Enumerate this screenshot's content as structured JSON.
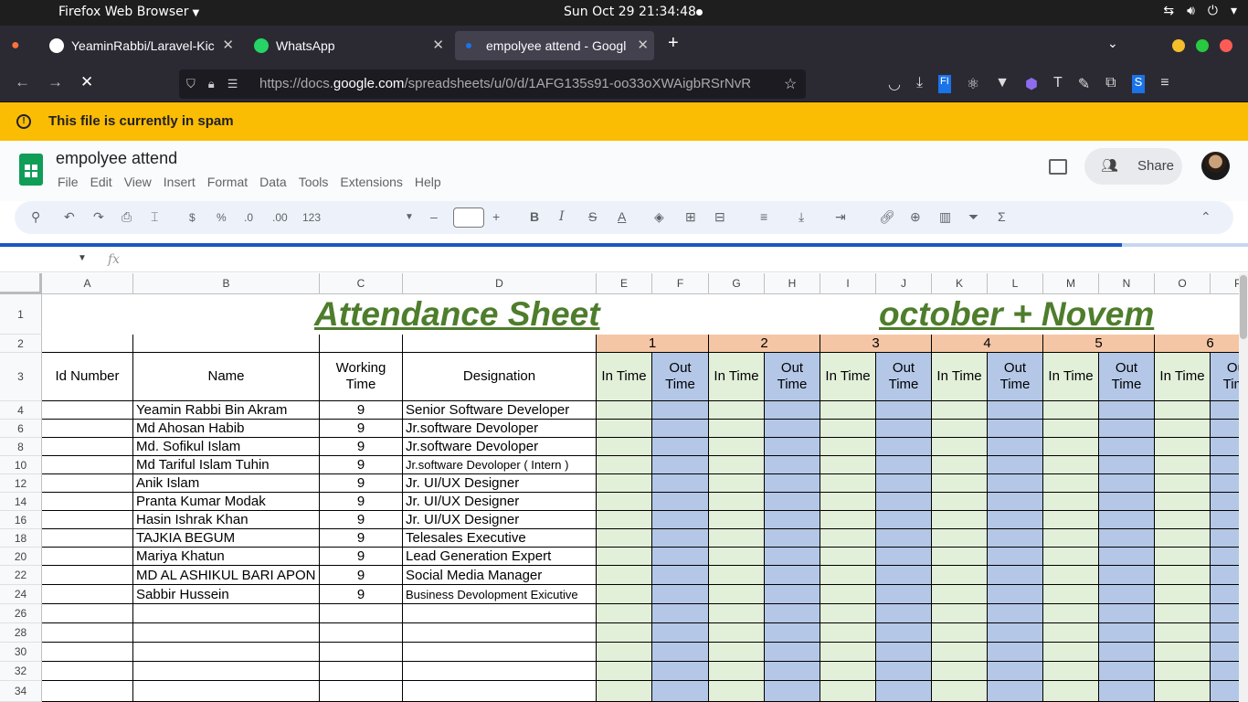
{
  "os_bar": {
    "app_name": "Firefox Web Browser",
    "clock": "Sun Oct 29  21:34:48"
  },
  "tabs": [
    {
      "label": "YeaminRabbi/Laravel-Kic",
      "icon_color": "#ffffff",
      "active": false
    },
    {
      "label": "WhatsApp",
      "icon_color": "#25d366",
      "active": false
    },
    {
      "label": "empolyee attend - Googl",
      "icon_color": "#1a73e8",
      "active": true
    }
  ],
  "url": {
    "prefix": "https://docs.",
    "host": "google.com",
    "path": "/spreadsheets/u/0/d/1AFG135s91-oo33oXWAigbRSrNvR"
  },
  "banner": {
    "message": "This file is currently in spam"
  },
  "doc": {
    "title": "empolyee attend",
    "menu": [
      "File",
      "Edit",
      "View",
      "Insert",
      "Format",
      "Data",
      "Tools",
      "Extensions",
      "Help"
    ],
    "share_label": "Share"
  },
  "toolbar": {
    "currency": "$",
    "percent": "%",
    "dec_decrease": ".0",
    "dec_increase": ".00",
    "number_format": "123",
    "bold": "B",
    "italic": "I",
    "strike": "S",
    "textcolor": "A"
  },
  "formula_bar": {
    "fx": "fx"
  },
  "sheet": {
    "columns": [
      "A",
      "B",
      "C",
      "D",
      "E",
      "F",
      "G",
      "H",
      "I",
      "J",
      "K",
      "L",
      "M",
      "N",
      "O",
      "P"
    ],
    "row_numbers": [
      "1",
      "2",
      "3",
      "4",
      "6",
      "8",
      "10",
      "12",
      "14",
      "16",
      "18",
      "20",
      "22",
      "24",
      "26",
      "28",
      "30",
      "32",
      "34"
    ],
    "title_left": "Attendance Sheet",
    "title_right": "october + Novem",
    "day_numbers": [
      "1",
      "2",
      "3",
      "4",
      "5",
      "6"
    ],
    "headers": {
      "id": "Id Number",
      "name": "Name",
      "working": "Working Time",
      "designation": "Designation",
      "in_time": "In Time",
      "out_time": "Out Time"
    },
    "employees": [
      {
        "name": "Yeamin Rabbi Bin Akram",
        "hours": "9",
        "designation": "Senior Software Developer"
      },
      {
        "name": "Md Ahosan Habib",
        "hours": "9",
        "designation": "Jr.software Devoloper"
      },
      {
        "name": "Md. Sofikul Islam",
        "hours": "9",
        "designation": "Jr.software Devoloper"
      },
      {
        "name": "Md Tariful Islam Tuhin",
        "hours": "9",
        "designation": "Jr.software Devoloper ( Intern )"
      },
      {
        "name": "Anik Islam",
        "hours": "9",
        "designation": "Jr. UI/UX Designer"
      },
      {
        "name": "Pranta Kumar Modak",
        "hours": "9",
        "designation": "Jr. UI/UX Designer"
      },
      {
        "name": "Hasin Ishrak Khan",
        "hours": "9",
        "designation": "Jr. UI/UX Designer"
      },
      {
        "name": "TAJKIA BEGUM",
        "hours": "9",
        "designation": "Telesales Executive"
      },
      {
        "name": "Mariya Khatun",
        "hours": "9",
        "designation": "Lead Generation Expert"
      },
      {
        "name": "MD AL ASHIKUL BARI APON",
        "hours": "9",
        "designation": "Social Media Manager"
      },
      {
        "name": "Sabbir Hussein",
        "hours": "9",
        "designation": "Business Devolopment Exicutive"
      }
    ]
  },
  "colors": {
    "banner": "#fbbc04",
    "title_green": "#4e7d2c",
    "day_header": "#f5c6a5",
    "in_cell": "#e2efd9",
    "out_cell": "#b4c7e7"
  }
}
